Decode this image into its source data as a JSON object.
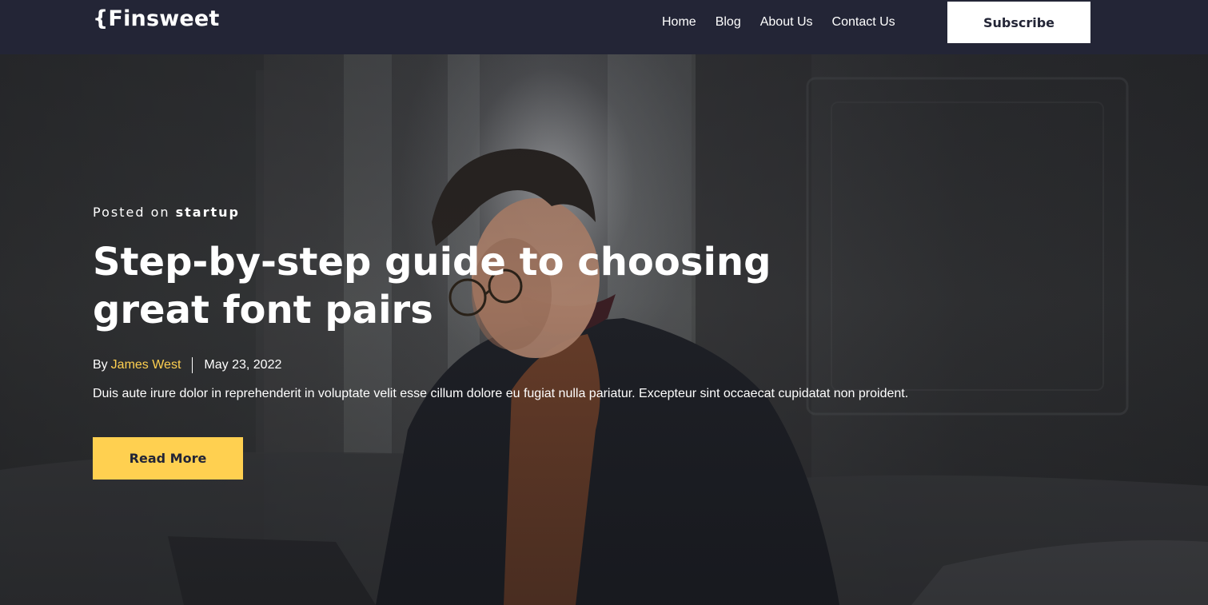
{
  "header": {
    "logo": "{Finsweet",
    "nav": [
      "Home",
      "Blog",
      "About Us",
      "Contact Us"
    ],
    "subscribe_label": "Subscribe"
  },
  "hero": {
    "posted_prefix": "Posted on",
    "category": "startup",
    "title": "Step-by-step guide to choosing great font pairs",
    "by_label": "By",
    "author": "James West",
    "date": "May 23, 2022",
    "excerpt": "Duis aute irure dolor in reprehenderit in voluptate velit esse cillum dolore eu fugiat nulla pariatur. Excepteur sint occaecat cupidatat non proident.",
    "read_more_label": "Read More"
  },
  "colors": {
    "header_bg": "#232536",
    "accent": "#ffd050",
    "subscribe_bg": "#ffffff"
  }
}
